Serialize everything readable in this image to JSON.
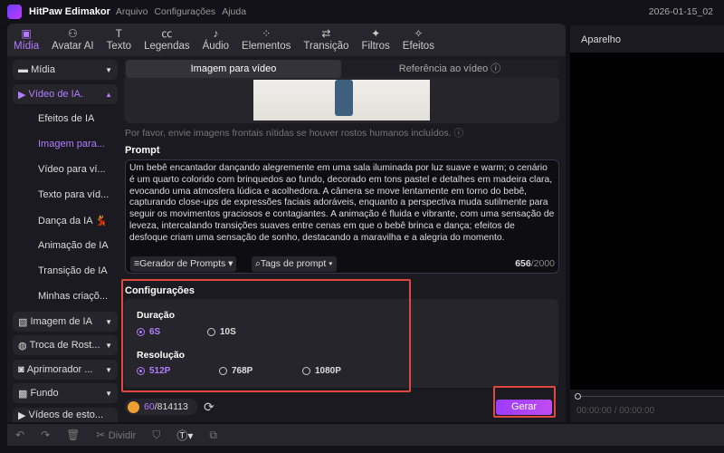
{
  "app": {
    "name": "HitPaw Edimakor",
    "menus": [
      "Arquivo",
      "Configurações",
      "Ajuda"
    ],
    "date": "2026-01-15_02"
  },
  "toolbar": [
    {
      "label": "Mídia",
      "icon": "media-icon"
    },
    {
      "label": "Avatar AI",
      "icon": "avatar-icon"
    },
    {
      "label": "Texto",
      "icon": "text-icon"
    },
    {
      "label": "Legendas",
      "icon": "captions-icon"
    },
    {
      "label": "Áudio",
      "icon": "audio-icon"
    },
    {
      "label": "Elementos",
      "icon": "elements-icon"
    },
    {
      "label": "Transição",
      "icon": "transition-icon"
    },
    {
      "label": "Filtros",
      "icon": "filters-icon"
    },
    {
      "label": "Efeitos",
      "icon": "effects-icon"
    }
  ],
  "sidebar": {
    "groups": [
      {
        "label": "Mídia"
      },
      {
        "label": "Vídeo de IA."
      },
      {
        "label": "Imagem de IA"
      },
      {
        "label": "Troca de Rost..."
      },
      {
        "label": "Aprimorador ..."
      },
      {
        "label": "Fundo"
      },
      {
        "label": "Vídeos de esto..."
      }
    ],
    "sub": [
      "Efeitos de IA",
      "Imagem para...",
      "Vídeo para ví...",
      "Texto para víd...",
      "Dança da IA 💃",
      "Animação de IA",
      "Transição de IA",
      "Minhas criaçõ..."
    ]
  },
  "tabs": {
    "active": "Imagem para vídeo",
    "other": "Referência ao vídeo ⓘ"
  },
  "notice": "Por favor, envie imagens frontais nítidas se houver rostos humanos incluídos. ⓘ",
  "prompt": {
    "label": "Prompt",
    "text": "Um bebê encantador dançando alegremente em uma sala iluminada por luz suave e warm; o cenário é um quarto colorido com brinquedos ao fundo, decorado em tons pastel e detalhes em madeira clara, evocando uma atmosfera lúdica e acolhedora. A câmera se move lentamente em torno do bebê, capturando close-ups de expressões faciais adoráveis, enquanto a perspectiva muda sutilmente para seguir os movimentos graciosos e contagiantes. A animação é fluida e vibrante, com uma sensação de leveza, intercalando transições suaves entre cenas em que o bebê brinca e dança; efeitos de desfoque criam uma sensação de sonho, destacando a maravilha e a alegria do momento.",
    "generator": "≡Gerador de Prompts ▾",
    "tags": "⌕Tags de prompt ▾",
    "count": "656",
    "max": "/2000"
  },
  "settings": {
    "label": "Configurações",
    "duration_label": "Duração",
    "durations": [
      "6S",
      "10S"
    ],
    "resolution_label": "Resolução",
    "resolutions": [
      "512P",
      "768P",
      "1080P"
    ]
  },
  "credits": {
    "used": "60",
    "total": "/814113"
  },
  "generate": "Gerar",
  "preview": {
    "title": "Aparelho",
    "time": "00:00:00 / 00:00:00"
  },
  "bottom": {
    "split": "Dividir"
  },
  "colors": {
    "accent": "#b57cff",
    "highlight": "#e0483f"
  }
}
